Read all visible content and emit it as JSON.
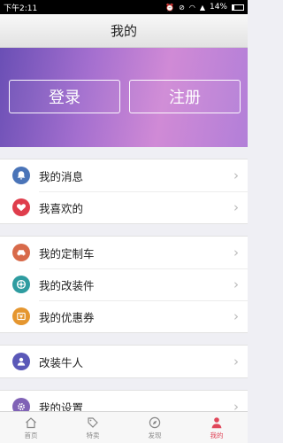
{
  "status_bar": {
    "time": "下午2:11",
    "battery": "14%"
  },
  "header": {
    "title": "我的"
  },
  "hero": {
    "login_label": "登录",
    "register_label": "注册"
  },
  "groups": [
    {
      "items": [
        {
          "label": "我的消息",
          "icon": "bell-icon",
          "color": "#4a74b8"
        },
        {
          "label": "我喜欢的",
          "icon": "heart-icon",
          "color": "#df3d4c"
        }
      ]
    },
    {
      "items": [
        {
          "label": "我的定制车",
          "icon": "car-icon",
          "color": "#d86a4a"
        },
        {
          "label": "我的改装件",
          "icon": "wheel-icon",
          "color": "#2e9ca0"
        },
        {
          "label": "我的优惠券",
          "icon": "coupon-icon",
          "color": "#e5962f"
        }
      ]
    },
    {
      "items": [
        {
          "label": "改装牛人",
          "icon": "person-icon",
          "color": "#5a58b8"
        }
      ]
    },
    {
      "items": [
        {
          "label": "我的设置",
          "icon": "gear-icon",
          "color": "#8062b6"
        }
      ]
    }
  ],
  "tabbar": {
    "items": [
      {
        "label": "首页",
        "icon": "home-icon"
      },
      {
        "label": "特卖",
        "icon": "tag-icon"
      },
      {
        "label": "发现",
        "icon": "compass-icon"
      },
      {
        "label": "我的",
        "icon": "user-icon"
      }
    ],
    "active_index": 3,
    "active_color": "#e0475a"
  }
}
